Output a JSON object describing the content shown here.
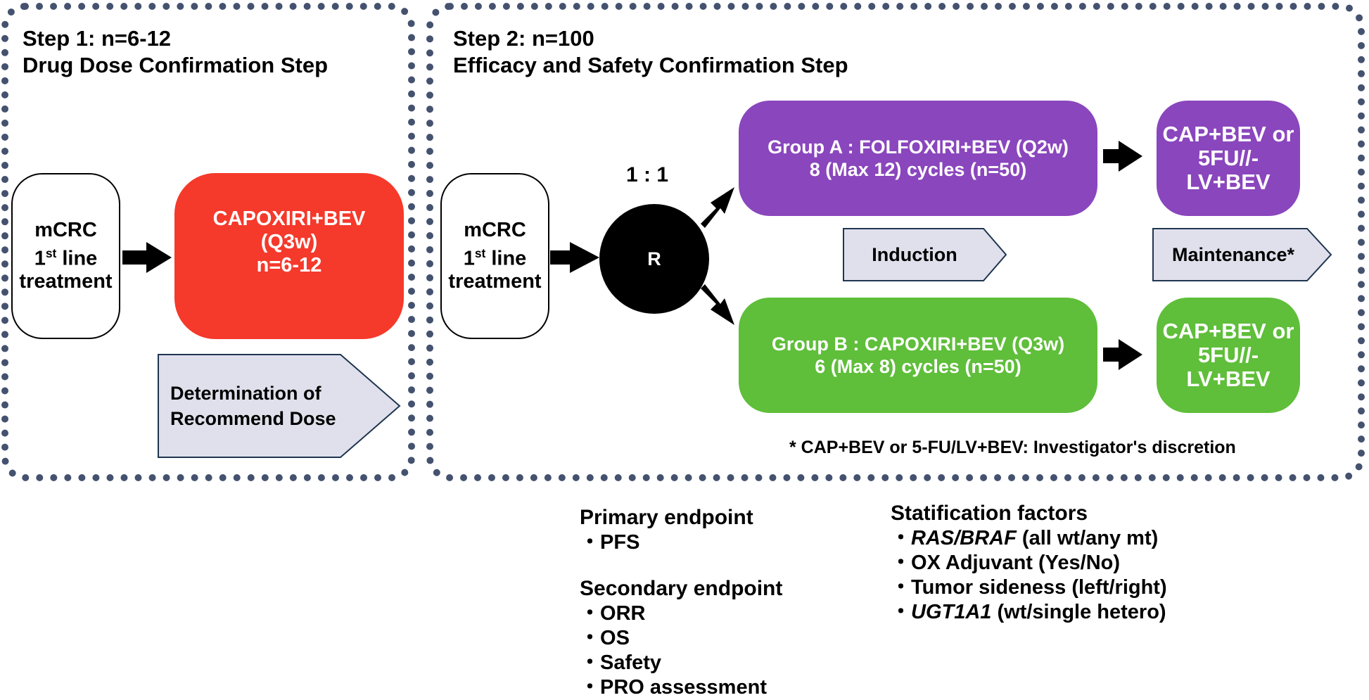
{
  "colors": {
    "panel_border": "#44526f",
    "red": "#f5392b",
    "purple": "#8a46bd",
    "green": "#5fbe3a",
    "pentagon_fill": "#e0e0ec",
    "pentagon_stroke": "#1f3550"
  },
  "step1": {
    "title_line1": "Step 1: n=6-12",
    "title_line2": "Drug Dose Confirmation Step",
    "population": {
      "line1": "mCRC",
      "line2_num": "1",
      "line2_sup": "st",
      "line2_rest": " line",
      "line3": "treatment"
    },
    "treatment": {
      "line1": "CAPOXIRI+BEV",
      "line2": "(Q3w)",
      "line3": "n=6-12"
    },
    "phase_label": {
      "line1": "Determination of",
      "line2": "Recommend Dose"
    }
  },
  "step2": {
    "title_line1": "Step 2: n=100",
    "title_line2": "Efficacy and Safety Confirmation Step",
    "population": {
      "line1": "mCRC",
      "line2_num": "1",
      "line2_sup": "st",
      "line2_rest": " line",
      "line3": "treatment"
    },
    "randomization": {
      "symbol": "R",
      "ratio": "1 : 1"
    },
    "group_a": {
      "induction_line1": "Group A : FOLFOXIRI+BEV (Q2w)",
      "induction_line2": "8 (Max 12) cycles (n=50)",
      "maintenance_line1": "CAP+BEV or",
      "maintenance_line2": "5FU//-LV+BEV"
    },
    "group_b": {
      "induction_line1": "Group B : CAPOXIRI+BEV (Q3w)",
      "induction_line2": "6 (Max 8) cycles (n=50)",
      "maintenance_line1": "CAP+BEV or",
      "maintenance_line2": "5FU//-LV+BEV"
    },
    "phase_induction": "Induction",
    "phase_maintenance": "Maintenance*",
    "footnote": "* CAP+BEV or 5-FU/LV+BEV: Investigator's discretion"
  },
  "endpoints": {
    "primary_title": "Primary endpoint",
    "primary_items": [
      "PFS"
    ],
    "secondary_title": "Secondary endpoint",
    "secondary_items": [
      "ORR",
      "OS",
      "Safety",
      "PRO assessment"
    ],
    "bullet": "・"
  },
  "stratification": {
    "title": "Statification factors",
    "items": [
      {
        "italic": "RAS/BRAF",
        "rest": " (all wt/any mt)"
      },
      {
        "italic": "",
        "rest": "OX Adjuvant (Yes/No)"
      },
      {
        "italic": "",
        "rest": "Tumor sideness (left/right)"
      },
      {
        "italic": "UGT1A1",
        "rest": " (wt/single hetero)"
      }
    ]
  }
}
